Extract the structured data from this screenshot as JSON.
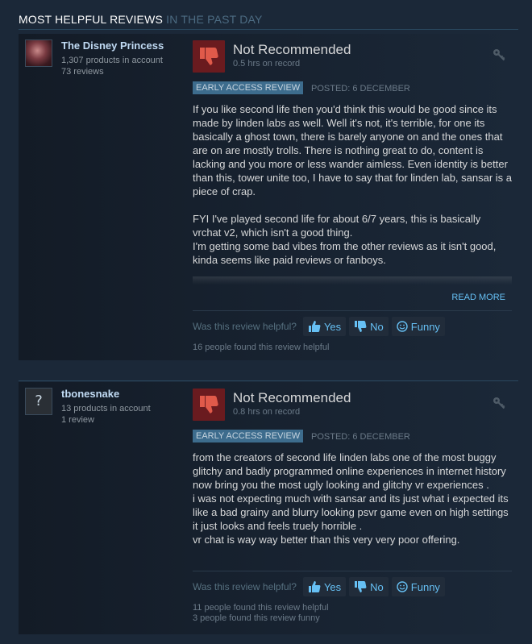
{
  "header": {
    "title_main": "MOST HELPFUL REVIEWS",
    "title_sub": "IN THE PAST DAY"
  },
  "reviews": [
    {
      "author": {
        "name": "The Disney Princess",
        "products": "1,307 products in account",
        "reviews": "73 reviews",
        "avatar": "avatar-image"
      },
      "verdict": "Not Recommended",
      "hours": "0.5 hrs on record",
      "badge": "EARLY ACCESS REVIEW",
      "posted": "POSTED: 6 DECEMBER",
      "paragraphs": [
        "If you like second life then you'd think this would be good since its made by linden labs as well. Well it's not, it's terrible, for one its basically a ghost town, there is barely anyone on and the ones that are on are mostly trolls. There is nothing great to do, content is lacking and you more or less wander aimless. Even identity is better than this, tower unite too, I have to say that for linden lab, sansar is a piece of crap.",
        "FYI I've played second life for about 6/7 years, this is basically vrchat v2, which isn't a good thing.\nI'm getting some bad vibes from the other reviews as it isn't good, kinda seems like paid reviews or fanboys."
      ],
      "read_more": "READ MORE",
      "helpful_question": "Was this review helpful?",
      "buttons": {
        "yes": "Yes",
        "no": "No",
        "funny": "Funny"
      },
      "found_helpful": "16 people found this review helpful",
      "found_funny": ""
    },
    {
      "author": {
        "name": "tbonesnake",
        "products": "13 products in account",
        "reviews": "1 review",
        "avatar": "?"
      },
      "verdict": "Not Recommended",
      "hours": "0.8 hrs on record",
      "badge": "EARLY ACCESS REVIEW",
      "posted": "POSTED: 6 DECEMBER",
      "paragraphs": [
        "from the creators of second life linden labs one of the most buggy glitchy and badly programmed online experiences in internet history now bring you the most ugly looking and glitchy vr experiences .\ni was not expecting much with sansar and its just what i expected its like a bad grainy and blurry looking psvr game even on high settings it just looks and feels truely horrible .\nvr chat is way way better than this very very poor offering."
      ],
      "read_more": "",
      "helpful_question": "Was this review helpful?",
      "buttons": {
        "yes": "Yes",
        "no": "No",
        "funny": "Funny"
      },
      "found_helpful": "11 people found this review helpful",
      "found_funny": "3 people found this review funny"
    }
  ],
  "colors": {
    "background": "#1b2838",
    "accent": "#66c0f4",
    "thumb_down_bg": "#6a1b1f",
    "badge_bg": "#3d6c8d"
  },
  "icons": {
    "verdict": "thumbs-down-icon",
    "key": "key-icon",
    "yes": "thumbs-up-icon",
    "no": "thumbs-down-icon",
    "funny": "smiley-icon"
  }
}
